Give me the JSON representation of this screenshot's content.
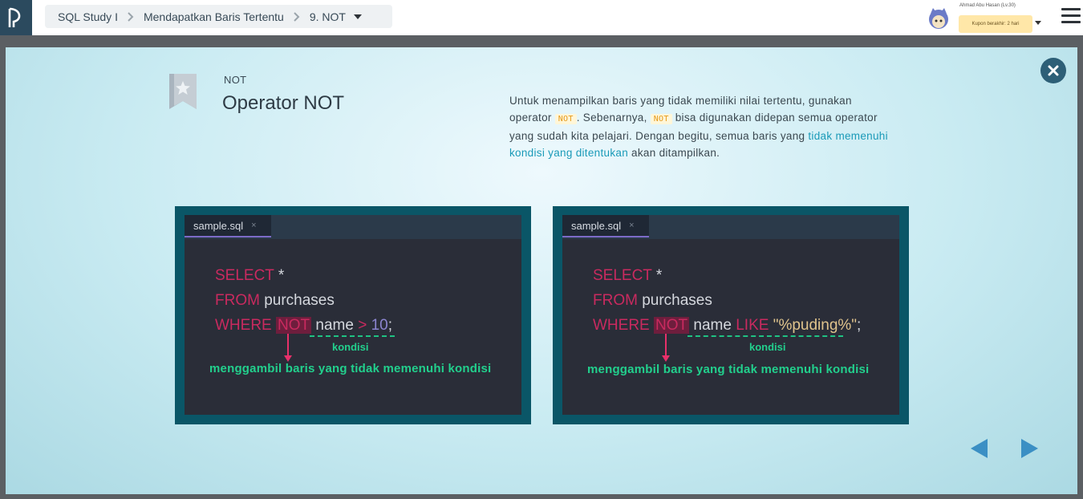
{
  "breadcrumb": {
    "course": "SQL Study I",
    "chapter": "Mendapatkan Baris Tertentu",
    "slide": "9. NOT"
  },
  "user": {
    "name": "Ahmad Abu Hasan (Lv.30)",
    "coupon": "Kupon berakhir: 2 hari"
  },
  "slide": {
    "label": "NOT",
    "title": "Operator NOT",
    "desc": {
      "p1": "Untuk menampilkan baris yang tidak memiliki nilai tertentu, gunakan operator ",
      "chip1": "NOT",
      "p2": ". Sebenarnya, ",
      "chip2": "NOT",
      "p3": " bisa digunakan didepan semua operator yang sudah kita pelajari. Dengan begitu, semua baris yang ",
      "highlight": "tidak memenuhi kondisi yang ditentukan",
      "p4": " akan ditampilkan."
    }
  },
  "examples": [
    {
      "tab": "sample.sql",
      "tab_close": "×",
      "line1_kw": "SELECT",
      "line1_rest": " *",
      "line2_kw": "FROM",
      "line2_rest": " purchases",
      "line3_kw": "WHERE",
      "line3_not": "NOT",
      "line3_col": "name",
      "line3_op": ">",
      "line3_val": "10",
      "line3_end": ";",
      "condition_label": "kondisi",
      "note": "menggambil baris yang tidak memenuhi kondisi"
    },
    {
      "tab": "sample.sql",
      "tab_close": "×",
      "line1_kw": "SELECT",
      "line1_rest": " *",
      "line2_kw": "FROM",
      "line2_rest": " purchases",
      "line3_kw": "WHERE",
      "line3_not": "NOT",
      "line3_col": "name",
      "line3_op": "LIKE",
      "line3_val": "\"%puding%\"",
      "line3_end": ";",
      "condition_label": "kondisi",
      "note": "menggambil baris yang tidak memenuhi kondisi"
    }
  ],
  "colors": {
    "keyword": "#c92a5f",
    "annotation": "#22d08d",
    "arrow": "#e8306a",
    "nav_arrow": "#3b8fc4"
  }
}
